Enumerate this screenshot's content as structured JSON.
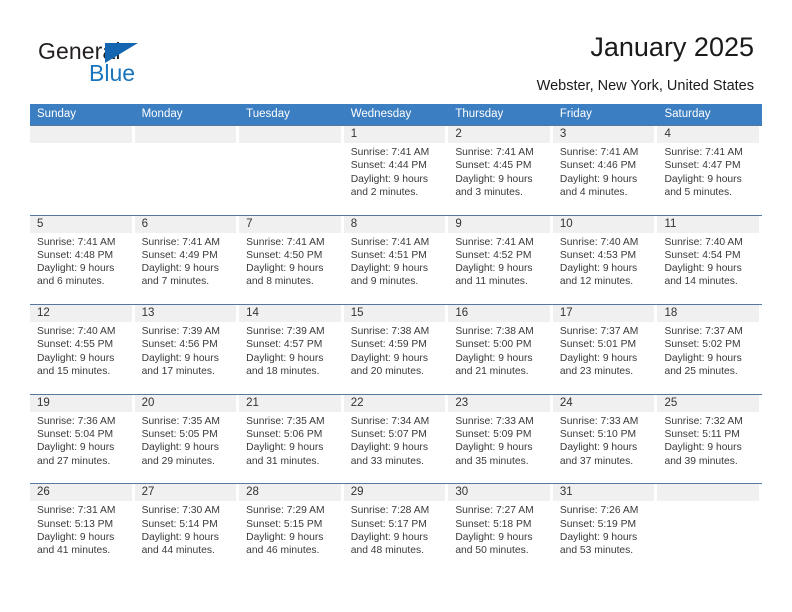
{
  "brand": {
    "line1": "General",
    "line2": "Blue",
    "triangle_icon": "triangle-icon",
    "color_primary": "#1c75bc",
    "color_text": "#231f20"
  },
  "header": {
    "title": "January 2025",
    "subtitle": "Webster, New York, United States"
  },
  "calendar": {
    "header_bg": "#3b7ec1",
    "daynum_bg": "#f0f0f0",
    "weekdays": [
      "Sunday",
      "Monday",
      "Tuesday",
      "Wednesday",
      "Thursday",
      "Friday",
      "Saturday"
    ],
    "weeks": [
      [
        {
          "day": "",
          "sunrise": "",
          "sunset": "",
          "daylight1": "",
          "daylight2": ""
        },
        {
          "day": "",
          "sunrise": "",
          "sunset": "",
          "daylight1": "",
          "daylight2": ""
        },
        {
          "day": "",
          "sunrise": "",
          "sunset": "",
          "daylight1": "",
          "daylight2": ""
        },
        {
          "day": "1",
          "sunrise": "Sunrise: 7:41 AM",
          "sunset": "Sunset: 4:44 PM",
          "daylight1": "Daylight: 9 hours",
          "daylight2": "and 2 minutes."
        },
        {
          "day": "2",
          "sunrise": "Sunrise: 7:41 AM",
          "sunset": "Sunset: 4:45 PM",
          "daylight1": "Daylight: 9 hours",
          "daylight2": "and 3 minutes."
        },
        {
          "day": "3",
          "sunrise": "Sunrise: 7:41 AM",
          "sunset": "Sunset: 4:46 PM",
          "daylight1": "Daylight: 9 hours",
          "daylight2": "and 4 minutes."
        },
        {
          "day": "4",
          "sunrise": "Sunrise: 7:41 AM",
          "sunset": "Sunset: 4:47 PM",
          "daylight1": "Daylight: 9 hours",
          "daylight2": "and 5 minutes."
        }
      ],
      [
        {
          "day": "5",
          "sunrise": "Sunrise: 7:41 AM",
          "sunset": "Sunset: 4:48 PM",
          "daylight1": "Daylight: 9 hours",
          "daylight2": "and 6 minutes."
        },
        {
          "day": "6",
          "sunrise": "Sunrise: 7:41 AM",
          "sunset": "Sunset: 4:49 PM",
          "daylight1": "Daylight: 9 hours",
          "daylight2": "and 7 minutes."
        },
        {
          "day": "7",
          "sunrise": "Sunrise: 7:41 AM",
          "sunset": "Sunset: 4:50 PM",
          "daylight1": "Daylight: 9 hours",
          "daylight2": "and 8 minutes."
        },
        {
          "day": "8",
          "sunrise": "Sunrise: 7:41 AM",
          "sunset": "Sunset: 4:51 PM",
          "daylight1": "Daylight: 9 hours",
          "daylight2": "and 9 minutes."
        },
        {
          "day": "9",
          "sunrise": "Sunrise: 7:41 AM",
          "sunset": "Sunset: 4:52 PM",
          "daylight1": "Daylight: 9 hours",
          "daylight2": "and 11 minutes."
        },
        {
          "day": "10",
          "sunrise": "Sunrise: 7:40 AM",
          "sunset": "Sunset: 4:53 PM",
          "daylight1": "Daylight: 9 hours",
          "daylight2": "and 12 minutes."
        },
        {
          "day": "11",
          "sunrise": "Sunrise: 7:40 AM",
          "sunset": "Sunset: 4:54 PM",
          "daylight1": "Daylight: 9 hours",
          "daylight2": "and 14 minutes."
        }
      ],
      [
        {
          "day": "12",
          "sunrise": "Sunrise: 7:40 AM",
          "sunset": "Sunset: 4:55 PM",
          "daylight1": "Daylight: 9 hours",
          "daylight2": "and 15 minutes."
        },
        {
          "day": "13",
          "sunrise": "Sunrise: 7:39 AM",
          "sunset": "Sunset: 4:56 PM",
          "daylight1": "Daylight: 9 hours",
          "daylight2": "and 17 minutes."
        },
        {
          "day": "14",
          "sunrise": "Sunrise: 7:39 AM",
          "sunset": "Sunset: 4:57 PM",
          "daylight1": "Daylight: 9 hours",
          "daylight2": "and 18 minutes."
        },
        {
          "day": "15",
          "sunrise": "Sunrise: 7:38 AM",
          "sunset": "Sunset: 4:59 PM",
          "daylight1": "Daylight: 9 hours",
          "daylight2": "and 20 minutes."
        },
        {
          "day": "16",
          "sunrise": "Sunrise: 7:38 AM",
          "sunset": "Sunset: 5:00 PM",
          "daylight1": "Daylight: 9 hours",
          "daylight2": "and 21 minutes."
        },
        {
          "day": "17",
          "sunrise": "Sunrise: 7:37 AM",
          "sunset": "Sunset: 5:01 PM",
          "daylight1": "Daylight: 9 hours",
          "daylight2": "and 23 minutes."
        },
        {
          "day": "18",
          "sunrise": "Sunrise: 7:37 AM",
          "sunset": "Sunset: 5:02 PM",
          "daylight1": "Daylight: 9 hours",
          "daylight2": "and 25 minutes."
        }
      ],
      [
        {
          "day": "19",
          "sunrise": "Sunrise: 7:36 AM",
          "sunset": "Sunset: 5:04 PM",
          "daylight1": "Daylight: 9 hours",
          "daylight2": "and 27 minutes."
        },
        {
          "day": "20",
          "sunrise": "Sunrise: 7:35 AM",
          "sunset": "Sunset: 5:05 PM",
          "daylight1": "Daylight: 9 hours",
          "daylight2": "and 29 minutes."
        },
        {
          "day": "21",
          "sunrise": "Sunrise: 7:35 AM",
          "sunset": "Sunset: 5:06 PM",
          "daylight1": "Daylight: 9 hours",
          "daylight2": "and 31 minutes."
        },
        {
          "day": "22",
          "sunrise": "Sunrise: 7:34 AM",
          "sunset": "Sunset: 5:07 PM",
          "daylight1": "Daylight: 9 hours",
          "daylight2": "and 33 minutes."
        },
        {
          "day": "23",
          "sunrise": "Sunrise: 7:33 AM",
          "sunset": "Sunset: 5:09 PM",
          "daylight1": "Daylight: 9 hours",
          "daylight2": "and 35 minutes."
        },
        {
          "day": "24",
          "sunrise": "Sunrise: 7:33 AM",
          "sunset": "Sunset: 5:10 PM",
          "daylight1": "Daylight: 9 hours",
          "daylight2": "and 37 minutes."
        },
        {
          "day": "25",
          "sunrise": "Sunrise: 7:32 AM",
          "sunset": "Sunset: 5:11 PM",
          "daylight1": "Daylight: 9 hours",
          "daylight2": "and 39 minutes."
        }
      ],
      [
        {
          "day": "26",
          "sunrise": "Sunrise: 7:31 AM",
          "sunset": "Sunset: 5:13 PM",
          "daylight1": "Daylight: 9 hours",
          "daylight2": "and 41 minutes."
        },
        {
          "day": "27",
          "sunrise": "Sunrise: 7:30 AM",
          "sunset": "Sunset: 5:14 PM",
          "daylight1": "Daylight: 9 hours",
          "daylight2": "and 44 minutes."
        },
        {
          "day": "28",
          "sunrise": "Sunrise: 7:29 AM",
          "sunset": "Sunset: 5:15 PM",
          "daylight1": "Daylight: 9 hours",
          "daylight2": "and 46 minutes."
        },
        {
          "day": "29",
          "sunrise": "Sunrise: 7:28 AM",
          "sunset": "Sunset: 5:17 PM",
          "daylight1": "Daylight: 9 hours",
          "daylight2": "and 48 minutes."
        },
        {
          "day": "30",
          "sunrise": "Sunrise: 7:27 AM",
          "sunset": "Sunset: 5:18 PM",
          "daylight1": "Daylight: 9 hours",
          "daylight2": "and 50 minutes."
        },
        {
          "day": "31",
          "sunrise": "Sunrise: 7:26 AM",
          "sunset": "Sunset: 5:19 PM",
          "daylight1": "Daylight: 9 hours",
          "daylight2": "and 53 minutes."
        },
        {
          "day": "",
          "sunrise": "",
          "sunset": "",
          "daylight1": "",
          "daylight2": ""
        }
      ]
    ]
  }
}
